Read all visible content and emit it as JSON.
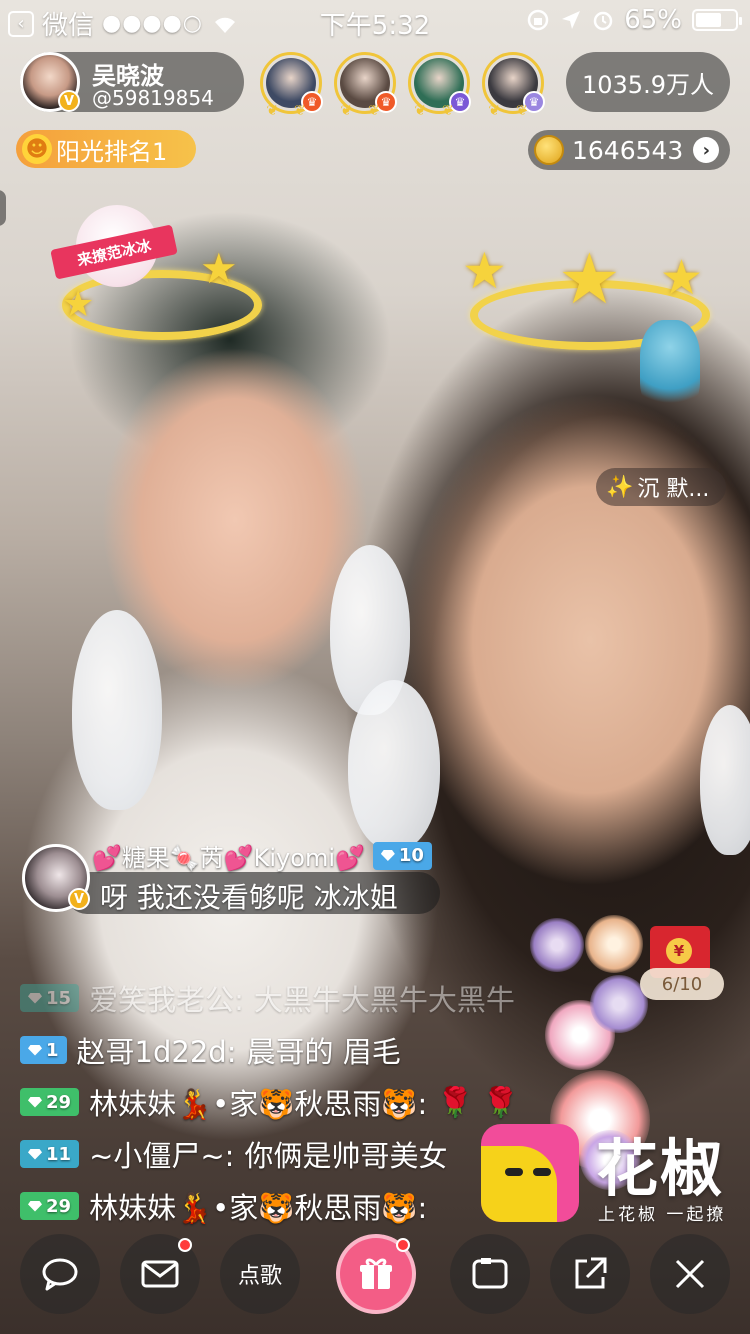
{
  "status_bar": {
    "back_app": "微信",
    "signal": "●●●●○",
    "time": "下午5:32",
    "battery": "65%",
    "battery_level": 0.65
  },
  "host": {
    "name": "吴晓波",
    "id": "@59819854",
    "verified_badge": "V"
  },
  "viewers": [
    {
      "name": "viewer-1",
      "color": "#3e4a64",
      "badge_color": "#f05a28"
    },
    {
      "name": "viewer-2",
      "color": "#5a4a42",
      "badge_color": "#f05a28"
    },
    {
      "name": "viewer-3",
      "color": "#2f6e56",
      "badge_color": "#7b58d6"
    },
    {
      "name": "viewer-4",
      "color": "#3b3a40",
      "badge_color": "#9a86e0"
    }
  ],
  "audience_count": "1035.9万人",
  "rank_label": "阳光排名1",
  "coin_count": "1646543",
  "sticker_text": "来撩范冰冰",
  "silence_label": "沉 默...",
  "featured_comment": {
    "user": "💕糖果🍬芮💕Kiyomi💕",
    "level": "10",
    "level_color": "#4aa8e8",
    "text": "呀 我还没看够呢 冰冰姐"
  },
  "chat": [
    {
      "level": "15",
      "color": "#3aa89a",
      "user": "爱笑我老公:",
      "text": "大黑牛大黑牛大黑牛",
      "faded": true
    },
    {
      "level": "1",
      "color": "#4aa8e8",
      "user": "赵哥1d22d:",
      "text": "晨哥的 眉毛",
      "faded": false
    },
    {
      "level": "29",
      "color": "#3fbf6a",
      "user": "林妹妹💃•家🐯秋思雨🐯:",
      "text": "🌹 🌹",
      "faded": false
    },
    {
      "level": "11",
      "color": "#3aa8c8",
      "user": "~小僵尸~:",
      "text": "你俩是帅哥美女",
      "faded": false
    },
    {
      "level": "29",
      "color": "#3fbf6a",
      "user": "林妹妹💃•家🐯秋思雨🐯:",
      "text": "",
      "faded": false
    }
  ],
  "red_packet": {
    "count": "6/10",
    "symbol": "¥"
  },
  "brand": {
    "name": "花椒",
    "slogan": "上花椒 一起撩"
  },
  "toolbar": {
    "song_label": "点歌"
  },
  "colors": {
    "gift": "#f35d86",
    "rank": "#f5a03c",
    "red_dot": "#ff3b3b"
  }
}
